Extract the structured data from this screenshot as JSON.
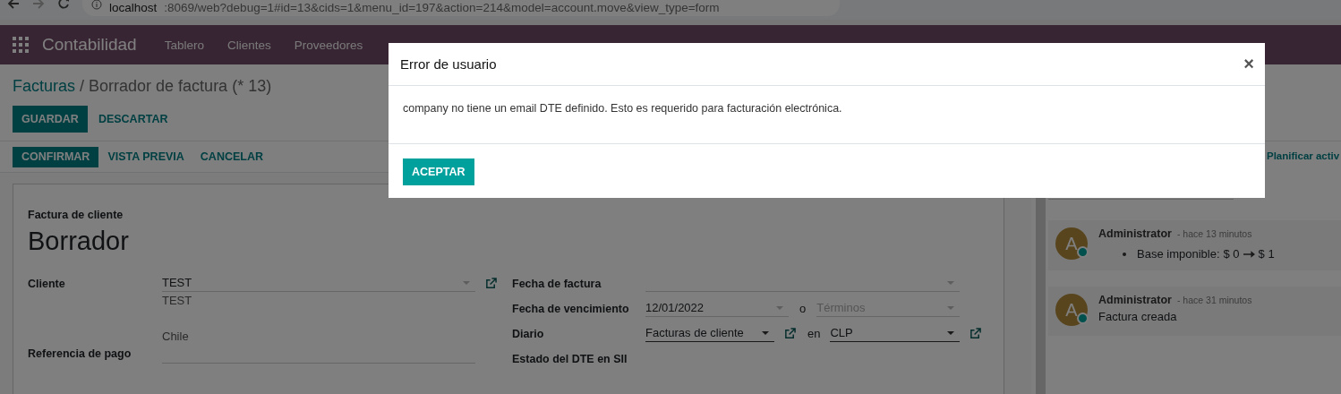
{
  "browser": {
    "host": "localhost",
    "path": ":8069/web?debug=1#id=13&cids=1&menu_id=197&action=214&model=account.move&view_type=form"
  },
  "navbar": {
    "app": "Contabilidad",
    "menu": [
      "Tablero",
      "Clientes",
      "Proveedores"
    ]
  },
  "breadcrumb": {
    "parent": "Facturas",
    "separator": "/",
    "current": "Borrador de factura (* 13)"
  },
  "actions": [
    {
      "label": "GUARDAR",
      "kind": "primary"
    },
    {
      "label": "DESCARTAR",
      "kind": "link"
    }
  ],
  "status_actions": [
    {
      "label": "CONFIRMAR",
      "kind": "primary"
    },
    {
      "label": "VISTA PREVIA",
      "kind": "link"
    },
    {
      "label": "CANCELAR",
      "kind": "link"
    }
  ],
  "form": {
    "type_label": "Factura de cliente",
    "name": "Borrador",
    "customer": {
      "label": "Cliente",
      "value": "TEST",
      "address": [
        "TEST",
        "Chile"
      ]
    },
    "payment_ref": {
      "label": "Referencia de pago"
    },
    "invoice_date": {
      "label": "Fecha de factura"
    },
    "due_date": {
      "label": "Fecha de vencimiento",
      "value": "12/01/2022",
      "or": "o",
      "terms_placeholder": "Términos"
    },
    "journal": {
      "label": "Diario",
      "value": "Facturas de cliente",
      "in": "en",
      "currency": "CLP"
    },
    "dte_state": {
      "label": "Estado del DTE en SII"
    }
  },
  "chatter": {
    "schedule": "Planificar activ",
    "messages": [
      {
        "kind": "tracking",
        "avatar": "A",
        "author": "Administrator",
        "time": "- hace 13 minutos",
        "field": "Base imponible:",
        "old": "$ 0",
        "new": "$ 1"
      },
      {
        "kind": "note",
        "avatar": "A",
        "author": "Administrator",
        "time": "- hace 31 minutos",
        "body": "Factura creada"
      }
    ]
  },
  "dialog": {
    "title": "Error de usuario",
    "close": "×",
    "body": "company no tiene un email DTE definido. Esto es requerido para facturación electrónica.",
    "button": "ACEPTAR"
  }
}
